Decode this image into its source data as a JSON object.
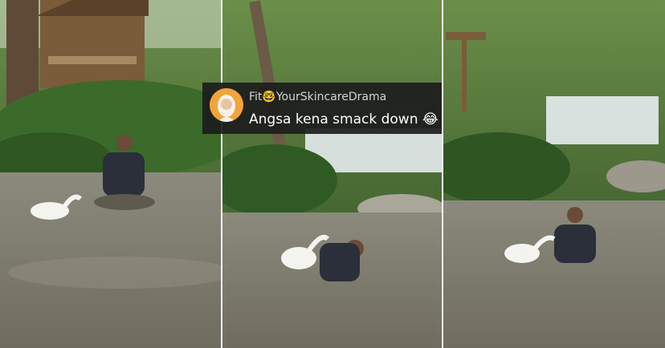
{
  "panels": [
    {
      "label": "frame-1"
    },
    {
      "label": "frame-2"
    },
    {
      "label": "frame-3"
    }
  ],
  "comment": {
    "username_prefix": "Fit",
    "username_emoji": "🤓",
    "username_suffix": "YourSkincareDrama",
    "text": "Angsa kena smack down",
    "text_emoji": "😂",
    "avatar_color": "#f2a33a",
    "background_color": "#1c1c1c"
  },
  "colors": {
    "water": "#7d7a6e",
    "foliage": "#3f6a2c",
    "sky": "#e6ecef"
  }
}
